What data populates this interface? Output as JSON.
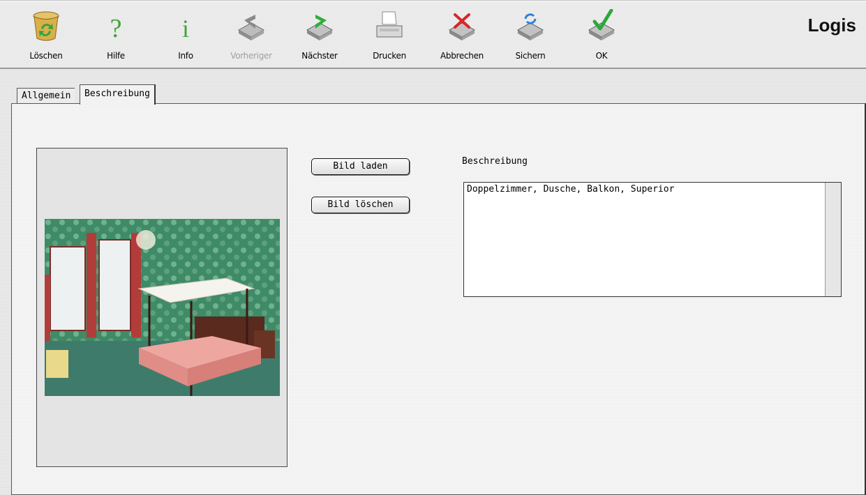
{
  "app": {
    "title": "Logis"
  },
  "toolbar": {
    "buttons": [
      {
        "label": "Löschen",
        "icon": "trash-icon",
        "disabled": false
      },
      {
        "label": "Hilfe",
        "icon": "help-icon",
        "disabled": false
      },
      {
        "label": "Info",
        "icon": "info-icon",
        "disabled": false
      },
      {
        "label": "Vorheriger",
        "icon": "previous-record-icon",
        "disabled": true
      },
      {
        "label": "Nächster",
        "icon": "next-record-icon",
        "disabled": false
      },
      {
        "label": "Drucken",
        "icon": "printer-icon",
        "disabled": false
      },
      {
        "label": "Abbrechen",
        "icon": "cancel-icon",
        "disabled": false
      },
      {
        "label": "Sichern",
        "icon": "save-icon",
        "disabled": false
      },
      {
        "label": "OK",
        "icon": "ok-checkmark-icon",
        "disabled": false
      }
    ]
  },
  "tabs": [
    {
      "label": "Allgemein",
      "active": false
    },
    {
      "label": "Beschreibung",
      "active": true
    }
  ],
  "image_panel": {
    "load_button": "Bild laden",
    "delete_button": "Bild löschen",
    "image_subject": "hotel-room-photo"
  },
  "description": {
    "label": "Beschreibung",
    "value": "Doppelzimmer, Dusche, Balkon, Superior"
  },
  "colors": {
    "trash_green": "#37a13a",
    "next_green": "#2fae3a",
    "cancel_red": "#d8262a",
    "ok_green": "#2aa83a",
    "sync_blue": "#2e7fe0"
  }
}
